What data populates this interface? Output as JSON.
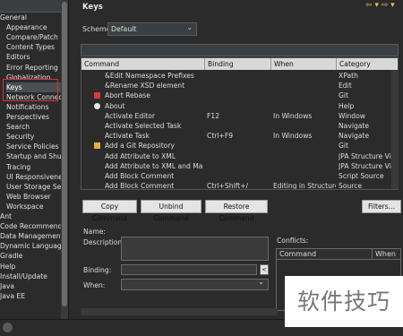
{
  "tree": {
    "items": [
      {
        "label": "General",
        "child": false
      },
      {
        "label": "Appearance",
        "child": true
      },
      {
        "label": "Compare/Patch",
        "child": true
      },
      {
        "label": "Content Types",
        "child": true
      },
      {
        "label": "Editors",
        "child": true
      },
      {
        "label": "Error Reporting",
        "child": true
      },
      {
        "label": "Globalization",
        "child": true
      },
      {
        "label": "Keys",
        "child": true,
        "selected": true
      },
      {
        "label": "Network Connecti",
        "child": true
      },
      {
        "label": "Notifications",
        "child": true
      },
      {
        "label": "Perspectives",
        "child": true
      },
      {
        "label": "Search",
        "child": true
      },
      {
        "label": "Security",
        "child": true
      },
      {
        "label": "Service Policies",
        "child": true
      },
      {
        "label": "Startup and Shutd",
        "child": true
      },
      {
        "label": "Tracing",
        "child": true
      },
      {
        "label": "UI Responsivenes",
        "child": true
      },
      {
        "label": "User Storage Serv",
        "child": true
      },
      {
        "label": "Web Browser",
        "child": true
      },
      {
        "label": "Workspace",
        "child": true
      },
      {
        "label": "Ant",
        "child": false
      },
      {
        "label": "Code Recommender",
        "child": false
      },
      {
        "label": "Data Management",
        "child": false
      },
      {
        "label": "Dynamic Languages",
        "child": false
      },
      {
        "label": "Gradle",
        "child": false
      },
      {
        "label": "Help",
        "child": false
      },
      {
        "label": "Install/Update",
        "child": false
      },
      {
        "label": "Java",
        "child": false
      },
      {
        "label": "Java EE",
        "child": false
      }
    ]
  },
  "header": {
    "title": "Keys",
    "nav": "⇦ ▾ ⇨ ▾"
  },
  "scheme": {
    "label": "Scheme:",
    "value": "Default",
    "chevron": "⌄"
  },
  "table": {
    "headers": [
      "Command",
      "Binding",
      "When",
      "Category"
    ],
    "rows": [
      {
        "command": "&Edit Namespace Prefixes",
        "binding": "",
        "when": "",
        "category": "XPath",
        "icon": ""
      },
      {
        "command": "&Rename XSD element",
        "binding": "",
        "when": "",
        "category": "Edit",
        "icon": ""
      },
      {
        "command": "Abort Rebase",
        "binding": "",
        "when": "",
        "category": "Git",
        "icon": "red"
      },
      {
        "command": "About",
        "binding": "",
        "when": "",
        "category": "Help",
        "icon": "info"
      },
      {
        "command": "Activate Editor",
        "binding": "F12",
        "when": "In Windows",
        "category": "Window",
        "icon": ""
      },
      {
        "command": "Activate Selected Task",
        "binding": "",
        "when": "",
        "category": "Navigate",
        "icon": ""
      },
      {
        "command": "Activate Task",
        "binding": "Ctrl+F9",
        "when": "In Windows",
        "category": "Navigate",
        "icon": ""
      },
      {
        "command": "Add a Git Repository",
        "binding": "",
        "when": "",
        "category": "Git",
        "icon": "git"
      },
      {
        "command": "Add Attribute to XML",
        "binding": "",
        "when": "",
        "category": "JPA Structure View",
        "icon": ""
      },
      {
        "command": "Add Attribute to XML and Map...",
        "binding": "",
        "when": "",
        "category": "JPA Structure View",
        "icon": ""
      },
      {
        "command": "Add Block Comment",
        "binding": "",
        "when": "",
        "category": "Script Source",
        "icon": ""
      },
      {
        "command": "Add Block Comment",
        "binding": "Ctrl+Shift+/",
        "when": "Editing in Structure...",
        "category": "Source",
        "icon": ""
      }
    ]
  },
  "buttons": {
    "copy": "Copy Command",
    "unbind": "Unbind Command",
    "restore": "Restore Command",
    "filters": "Filters..."
  },
  "details": {
    "name_label": "Name:",
    "description_label": "Description:",
    "binding_label": "Binding:",
    "when_label": "When:",
    "conflicts_label": "Conflicts:",
    "conflicts_headers": [
      "Command",
      "When"
    ]
  },
  "watermark": "软件技巧",
  "colors": {
    "selection": "#4b4f52",
    "highlight_box": "#e03030",
    "table_header": "#d8d8d8"
  }
}
